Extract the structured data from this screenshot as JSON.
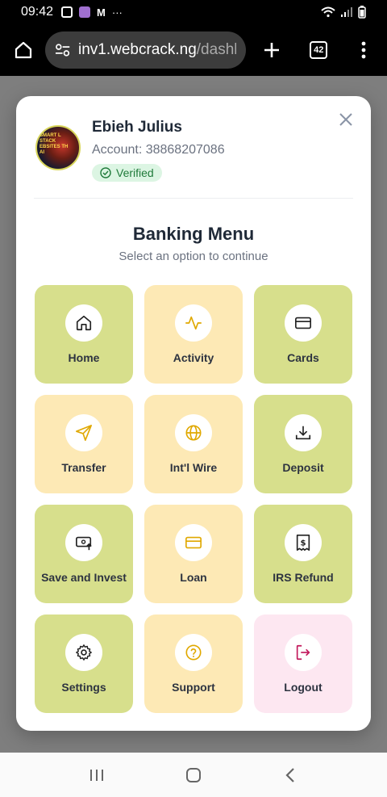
{
  "status": {
    "time": "09:42",
    "dots": "···"
  },
  "browser": {
    "url_domain": "inv1.webcrack.ng",
    "url_path": "/dashb",
    "tab_count": "42"
  },
  "profile": {
    "name": "Ebieh Julius",
    "account": "Account: 38868207086",
    "verified": "Verified",
    "avatar_text": "SMART L STACK EBSITES TH AI"
  },
  "menu": {
    "title": "Banking Menu",
    "subtitle": "Select an option to continue",
    "items": [
      {
        "label": "Home",
        "icon": "home-icon",
        "color": "green"
      },
      {
        "label": "Activity",
        "icon": "activity-icon",
        "color": "yellow"
      },
      {
        "label": "Cards",
        "icon": "card-icon",
        "color": "green"
      },
      {
        "label": "Transfer",
        "icon": "send-icon",
        "color": "yellow"
      },
      {
        "label": "Int'l Wire",
        "icon": "globe-icon",
        "color": "yellow"
      },
      {
        "label": "Deposit",
        "icon": "download-icon",
        "color": "green"
      },
      {
        "label": "Save and Invest",
        "icon": "money-up-icon",
        "color": "green"
      },
      {
        "label": "Loan",
        "icon": "card-icon",
        "color": "yellow"
      },
      {
        "label": "IRS Refund",
        "icon": "receipt-icon",
        "color": "green"
      },
      {
        "label": "Settings",
        "icon": "gear-icon",
        "color": "green"
      },
      {
        "label": "Support",
        "icon": "help-icon",
        "color": "yellow"
      },
      {
        "label": "Logout",
        "icon": "logout-icon",
        "color": "pink"
      }
    ]
  },
  "colors": {
    "green_tile": "#d7df8c",
    "yellow_tile": "#fde9b5",
    "pink_tile": "#fde7f1",
    "verified_bg": "#dcf5e3",
    "verified_text": "#1f7a3a"
  }
}
